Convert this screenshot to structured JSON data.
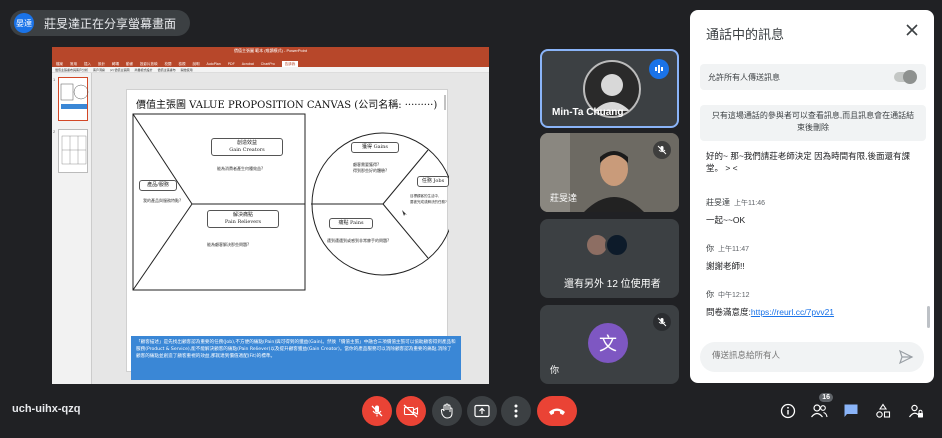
{
  "presenter": {
    "avatar_text": "晏達",
    "text": "莊旻達正在分享螢幕畫面"
  },
  "share": {
    "ppt_title": "價值主張圖 範本 (唯讀模式) - PowerPoint",
    "ribbon_tabs": [
      "檔案",
      "常用",
      "插入",
      "設計",
      "轉場",
      "動畫",
      "投影片放映",
      "校閱",
      "檢視",
      "說明",
      "AutoPlan",
      "PDF",
      "Acrobat",
      "ChartPro",
      "告訴我"
    ],
    "ribbon_active": 14,
    "bar_items": [
      "價值主張畫布與客戶分析",
      "客戶洞察",
      "(2) 價值主張圖",
      "商業模式設計",
      "價值主張畫布",
      "開始使用"
    ],
    "slide_title": "價值主張圖 VALUE PROPOSITION CANVAS  (公司名稱: ·········)",
    "labels": {
      "gain_creators": "創造效益\nGain Creators",
      "products": "產品/服務",
      "pain_relievers": "解決痛點\nPain Relievers",
      "gains": "獲得 Gains",
      "jobs": "任務 Jobs",
      "pains": "痛點 Pains"
    },
    "notes": {
      "gain_creators": "能為消費者產生何種效益?",
      "products": "我的產品與服務特點?",
      "pain_relievers": "能為顧客解決那些問題?",
      "gains": "顧客需要獲得?\n得到那些好的體驗?",
      "jobs": "目標顧客的生活中,\n要被完成或解決的任務?",
      "pains": "遭到遭遇到或感到非常棘手的問題?"
    },
    "description": "「顧客描述」是先找出顧客認為重要的任務(Job),不方便的痛點(Pain)與可得到的獲益(Gain)。然後「價值主張」中融合三項價值主張可以協助顧客得到產品和服務(Product & Service),能不能解決顧客的痛點(Pain Reliever)以及提升顧客獲益(Gain Creator)。當你的產品服務可以消除顧客認為重要的痛點,消除了顧客的痛點並創造了顧客重視的效益,那就達到價值適配(Fit)的標準。"
  },
  "tiles": [
    {
      "name": "Min-Ta Chuang",
      "state": "speaking"
    },
    {
      "name": "莊旻達",
      "state": "muted"
    },
    {
      "name": "還有另外 12 位使用者"
    },
    {
      "name": "你",
      "avatar_char": "文",
      "avatar_color": "#7e57c2",
      "state": "muted"
    }
  ],
  "chat": {
    "title": "通話中的訊息",
    "allow_label": "允許所有人傳送訊息",
    "info": "只有這場通話的參與者可以查看訊息,而且訊息會在通話結束後刪除",
    "messages": [
      {
        "text": "好的~ 那~我們請莊老師決定 因為時間有限,後面還有課堂。 > <"
      },
      {
        "sender": "莊旻達",
        "time": "上午11:46",
        "text": "一起~~OK"
      },
      {
        "sender": "你",
        "time": "上午11:47",
        "text": "謝謝老師!!"
      },
      {
        "sender": "你",
        "time": "中午12:12",
        "text_prefix": "問卷滿意度:",
        "link": "https://reurl.cc/7pvv21"
      }
    ],
    "input_placeholder": "傳送訊息給所有人"
  },
  "meeting_code": "uch-uihx-qzq",
  "people_count": "16",
  "colors": {
    "accent": "#1a73e8",
    "danger": "#ea4335",
    "bg": "#202124"
  }
}
